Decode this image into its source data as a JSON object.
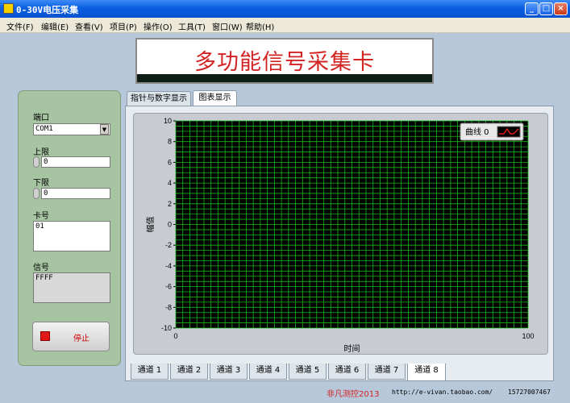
{
  "window": {
    "title": "0-30V电压采集",
    "min_label": "_",
    "max_label": "□",
    "close_label": "×"
  },
  "menu": [
    "文件(F)",
    "编辑(E)",
    "查看(V)",
    "项目(P)",
    "操作(O)",
    "工具(T)",
    "窗口(W)",
    "帮助(H)"
  ],
  "banner": {
    "title": "多功能信号采集卡"
  },
  "controls": {
    "port_label": "端口",
    "port_value": "COM1",
    "port_dd_icon": "▼",
    "upper_label": "上限",
    "upper_value": "0",
    "lower_label": "下限",
    "lower_value": "0",
    "card_label": "卡号",
    "card_value": "01",
    "signal_label": "信号",
    "signal_value": "FFFF",
    "stop_label": "停止"
  },
  "tabs": [
    "指针与数字显示",
    "图表显示"
  ],
  "active_tab": 1,
  "channels": [
    "通道 1",
    "通道 2",
    "通道 3",
    "通道 4",
    "通道 5",
    "通道 6",
    "通道 7",
    "通道 8"
  ],
  "active_channel": 7,
  "chart_data": {
    "type": "line",
    "xlabel": "时间",
    "ylabel": "幅值",
    "xlim": [
      0,
      100
    ],
    "ylim": [
      -10,
      10
    ],
    "x_ticks": [
      "0",
      "100"
    ],
    "y_ticks": [
      "10",
      "8",
      "6",
      "4",
      "2",
      "0",
      "-2",
      "-4",
      "-6",
      "-8",
      "-10"
    ],
    "grid": true,
    "legend_position": "top-right",
    "series": [
      {
        "name": "曲线 0",
        "values": []
      }
    ],
    "background": "#000000",
    "grid_color": "#18b818"
  },
  "footer": {
    "brand": "非凡测控2013",
    "url": "http://e-vivan.taobao.com/",
    "phone": "15727007467"
  },
  "colors": {
    "brand_red": "#d32424",
    "footer_red": "#d32424"
  }
}
